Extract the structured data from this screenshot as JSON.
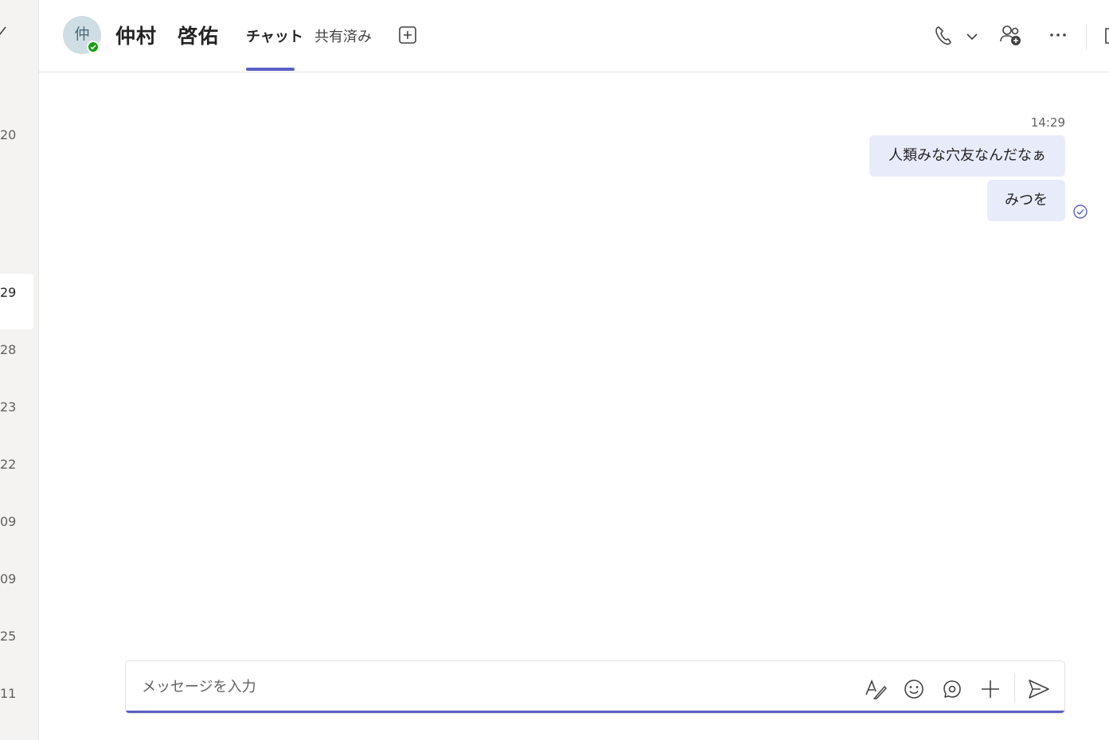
{
  "left_list": {
    "items": [
      {
        "time": "20"
      },
      {
        "time": "29"
      },
      {
        "time": "28"
      },
      {
        "time": "23"
      },
      {
        "time": "22"
      },
      {
        "time": "09"
      },
      {
        "time": "09"
      },
      {
        "time": "25"
      },
      {
        "time": "11"
      }
    ]
  },
  "header": {
    "avatar_initial": "仲",
    "title": "仲村　啓佑",
    "tabs": [
      {
        "label": "チャット",
        "active": true
      },
      {
        "label": "共有済み",
        "active": false
      }
    ]
  },
  "messages": {
    "time": "14:29",
    "items": [
      {
        "text": "人類みな穴友なんだなぁ"
      },
      {
        "text": "みつを"
      }
    ]
  },
  "composer": {
    "placeholder": "メッセージを入力"
  },
  "colors": {
    "accent": "#5b5fc7",
    "bubble": "#e8ebfa",
    "presence": "#13a10e"
  }
}
